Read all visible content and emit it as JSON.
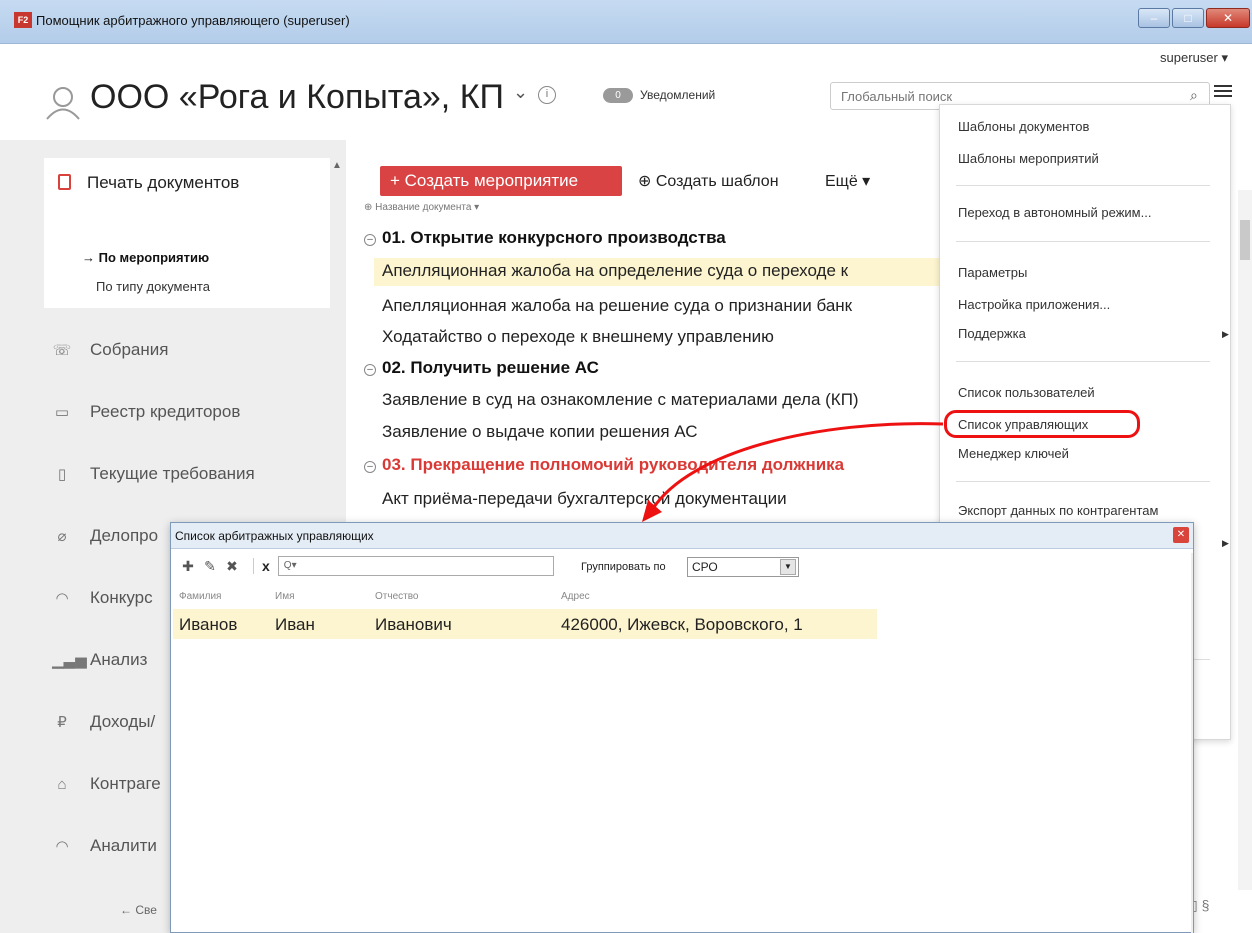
{
  "window": {
    "title": "Помощник арбитражного управляющего (superuser)",
    "app_icon": "F2",
    "minimize": "–",
    "maximize": "□",
    "close": "✕"
  },
  "header": {
    "user": "superuser ▾",
    "company": "ООО «Рога и Копыта», КП",
    "notifications_count": "0",
    "notifications_label": "Уведомлений",
    "search_placeholder": "Глобальный поиск"
  },
  "sidebar": {
    "print": {
      "title": "Печать документов",
      "by_event": "→ По мероприятию",
      "by_type": "По типу документа"
    },
    "items": [
      {
        "label": "Собрания",
        "icon": "handshake-icon"
      },
      {
        "label": "Реестр кредиторов",
        "icon": "registry-icon"
      },
      {
        "label": "Текущие требования",
        "icon": "document-icon"
      },
      {
        "label": "Делопро",
        "icon": "paperclip-icon"
      },
      {
        "label": "Конкурс",
        "icon": "contest-icon"
      },
      {
        "label": "Анализ",
        "icon": "chart-icon"
      },
      {
        "label": "Доходы/",
        "icon": "ruble-icon"
      },
      {
        "label": "Контраге",
        "icon": "bank-icon"
      },
      {
        "label": "Аналити",
        "icon": "analytics-icon"
      }
    ],
    "footer": "← Све"
  },
  "toolbar": {
    "create_event": "+ Создать мероприятие",
    "create_template": "⊕ Создать шаблон",
    "more": "Ещё ▾"
  },
  "documents": {
    "column_header": "Название документа ▾",
    "groups": [
      {
        "title": "01. Открытие конкурсного производства",
        "color": "#111111",
        "rows": [
          "Апелляционная жалоба на определение суда о переходе к",
          "Апелляционная жалоба на решение суда о признании банк",
          "Ходатайство о переходе к внешнему управлению"
        ]
      },
      {
        "title": "02. Получить решение АС",
        "color": "#111111",
        "rows": [
          "Заявление в суд на ознакомление с материалами дела (КП)",
          "Заявление о выдаче копии решения АС"
        ]
      },
      {
        "title": "03. Прекращение полномочий руководителя должника",
        "color": "#d93a36",
        "rows": [
          "Акт приёма-передачи бухгалтерской документации"
        ]
      }
    ]
  },
  "dropdown": {
    "items": [
      "Шаблоны документов",
      "Шаблоны мероприятий",
      "Переход в автономный режим...",
      "Параметры",
      "Настройка приложения...",
      "Поддержка",
      "Список пользователей",
      "Список управляющих",
      "Менеджер ключей",
      "Экспорт данных по контрагентам"
    ],
    "highlighted": "Список управляющих",
    "highlight_color": "#e11111"
  },
  "modal": {
    "title": "Список арбитражных управляющих",
    "toolbar_icons": [
      "add-icon",
      "edit-icon",
      "delete-icon"
    ],
    "clear": "x",
    "search_placeholder": "Q▾",
    "group_by_label": "Группировать по",
    "group_by_value": "СРО",
    "columns": [
      "Фамилия",
      "Имя",
      "Отчество",
      "Адрес"
    ],
    "rows": [
      {
        "surname": "Иванов",
        "name": "Иван",
        "patronymic": "Иванович",
        "address": "426000, Ижевск, Воровского, 1"
      }
    ]
  },
  "colors": {
    "accent_red": "#d94343",
    "selection_yellow": "#fdf5cf"
  }
}
